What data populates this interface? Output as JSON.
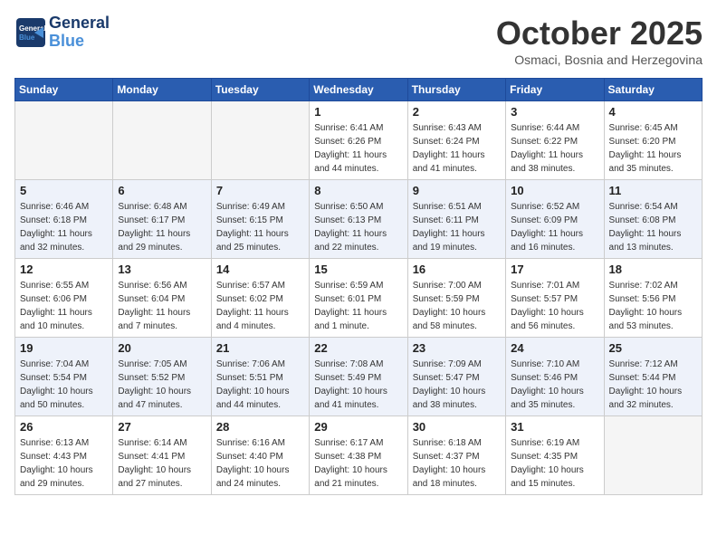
{
  "header": {
    "logo_general": "General",
    "logo_blue": "Blue",
    "month": "October 2025",
    "location": "Osmaci, Bosnia and Herzegovina"
  },
  "weekdays": [
    "Sunday",
    "Monday",
    "Tuesday",
    "Wednesday",
    "Thursday",
    "Friday",
    "Saturday"
  ],
  "weeks": [
    [
      {
        "day": "",
        "info": ""
      },
      {
        "day": "",
        "info": ""
      },
      {
        "day": "",
        "info": ""
      },
      {
        "day": "1",
        "info": "Sunrise: 6:41 AM\nSunset: 6:26 PM\nDaylight: 11 hours\nand 44 minutes."
      },
      {
        "day": "2",
        "info": "Sunrise: 6:43 AM\nSunset: 6:24 PM\nDaylight: 11 hours\nand 41 minutes."
      },
      {
        "day": "3",
        "info": "Sunrise: 6:44 AM\nSunset: 6:22 PM\nDaylight: 11 hours\nand 38 minutes."
      },
      {
        "day": "4",
        "info": "Sunrise: 6:45 AM\nSunset: 6:20 PM\nDaylight: 11 hours\nand 35 minutes."
      }
    ],
    [
      {
        "day": "5",
        "info": "Sunrise: 6:46 AM\nSunset: 6:18 PM\nDaylight: 11 hours\nand 32 minutes."
      },
      {
        "day": "6",
        "info": "Sunrise: 6:48 AM\nSunset: 6:17 PM\nDaylight: 11 hours\nand 29 minutes."
      },
      {
        "day": "7",
        "info": "Sunrise: 6:49 AM\nSunset: 6:15 PM\nDaylight: 11 hours\nand 25 minutes."
      },
      {
        "day": "8",
        "info": "Sunrise: 6:50 AM\nSunset: 6:13 PM\nDaylight: 11 hours\nand 22 minutes."
      },
      {
        "day": "9",
        "info": "Sunrise: 6:51 AM\nSunset: 6:11 PM\nDaylight: 11 hours\nand 19 minutes."
      },
      {
        "day": "10",
        "info": "Sunrise: 6:52 AM\nSunset: 6:09 PM\nDaylight: 11 hours\nand 16 minutes."
      },
      {
        "day": "11",
        "info": "Sunrise: 6:54 AM\nSunset: 6:08 PM\nDaylight: 11 hours\nand 13 minutes."
      }
    ],
    [
      {
        "day": "12",
        "info": "Sunrise: 6:55 AM\nSunset: 6:06 PM\nDaylight: 11 hours\nand 10 minutes."
      },
      {
        "day": "13",
        "info": "Sunrise: 6:56 AM\nSunset: 6:04 PM\nDaylight: 11 hours\nand 7 minutes."
      },
      {
        "day": "14",
        "info": "Sunrise: 6:57 AM\nSunset: 6:02 PM\nDaylight: 11 hours\nand 4 minutes."
      },
      {
        "day": "15",
        "info": "Sunrise: 6:59 AM\nSunset: 6:01 PM\nDaylight: 11 hours\nand 1 minute."
      },
      {
        "day": "16",
        "info": "Sunrise: 7:00 AM\nSunset: 5:59 PM\nDaylight: 10 hours\nand 58 minutes."
      },
      {
        "day": "17",
        "info": "Sunrise: 7:01 AM\nSunset: 5:57 PM\nDaylight: 10 hours\nand 56 minutes."
      },
      {
        "day": "18",
        "info": "Sunrise: 7:02 AM\nSunset: 5:56 PM\nDaylight: 10 hours\nand 53 minutes."
      }
    ],
    [
      {
        "day": "19",
        "info": "Sunrise: 7:04 AM\nSunset: 5:54 PM\nDaylight: 10 hours\nand 50 minutes."
      },
      {
        "day": "20",
        "info": "Sunrise: 7:05 AM\nSunset: 5:52 PM\nDaylight: 10 hours\nand 47 minutes."
      },
      {
        "day": "21",
        "info": "Sunrise: 7:06 AM\nSunset: 5:51 PM\nDaylight: 10 hours\nand 44 minutes."
      },
      {
        "day": "22",
        "info": "Sunrise: 7:08 AM\nSunset: 5:49 PM\nDaylight: 10 hours\nand 41 minutes."
      },
      {
        "day": "23",
        "info": "Sunrise: 7:09 AM\nSunset: 5:47 PM\nDaylight: 10 hours\nand 38 minutes."
      },
      {
        "day": "24",
        "info": "Sunrise: 7:10 AM\nSunset: 5:46 PM\nDaylight: 10 hours\nand 35 minutes."
      },
      {
        "day": "25",
        "info": "Sunrise: 7:12 AM\nSunset: 5:44 PM\nDaylight: 10 hours\nand 32 minutes."
      }
    ],
    [
      {
        "day": "26",
        "info": "Sunrise: 6:13 AM\nSunset: 4:43 PM\nDaylight: 10 hours\nand 29 minutes."
      },
      {
        "day": "27",
        "info": "Sunrise: 6:14 AM\nSunset: 4:41 PM\nDaylight: 10 hours\nand 27 minutes."
      },
      {
        "day": "28",
        "info": "Sunrise: 6:16 AM\nSunset: 4:40 PM\nDaylight: 10 hours\nand 24 minutes."
      },
      {
        "day": "29",
        "info": "Sunrise: 6:17 AM\nSunset: 4:38 PM\nDaylight: 10 hours\nand 21 minutes."
      },
      {
        "day": "30",
        "info": "Sunrise: 6:18 AM\nSunset: 4:37 PM\nDaylight: 10 hours\nand 18 minutes."
      },
      {
        "day": "31",
        "info": "Sunrise: 6:19 AM\nSunset: 4:35 PM\nDaylight: 10 hours\nand 15 minutes."
      },
      {
        "day": "",
        "info": ""
      }
    ]
  ]
}
